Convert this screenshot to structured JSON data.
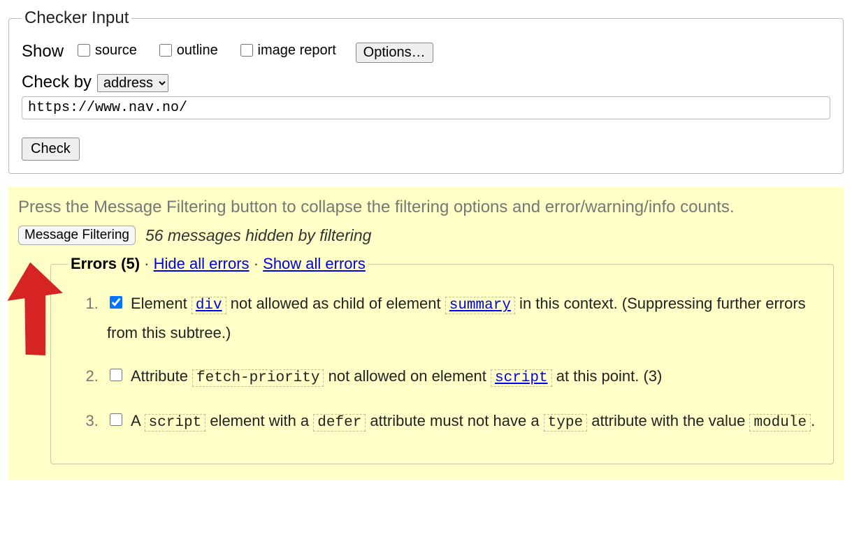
{
  "checker": {
    "legend": "Checker Input",
    "show_label": "Show",
    "source_label": "source",
    "outline_label": "outline",
    "image_report_label": "image report",
    "options_button": "Options…",
    "check_by_label": "Check by",
    "check_by_value": "address",
    "url_value": "https://www.nav.no/",
    "check_button": "Check"
  },
  "filter": {
    "hint": "Press the Message Filtering button to collapse the filtering options and error/warning/info counts.",
    "button": "Message Filtering",
    "hidden_text": "56 messages hidden by filtering"
  },
  "errors": {
    "title": "Errors (5)",
    "hide_all": "Hide all errors",
    "show_all": "Show all errors",
    "items": [
      {
        "checked": true,
        "parts": [
          {
            "text": "Element "
          },
          {
            "code": "div",
            "link": true
          },
          {
            "text": " not allowed as child of element "
          },
          {
            "code": "summary",
            "link": true
          },
          {
            "text": " in this context. (Suppressing further errors from this subtree.)"
          }
        ]
      },
      {
        "checked": false,
        "parts": [
          {
            "text": "Attribute "
          },
          {
            "code": "fetch-priority"
          },
          {
            "text": " not allowed on element "
          },
          {
            "code": "script",
            "link": true
          },
          {
            "text": " at this point. (3)"
          }
        ]
      },
      {
        "checked": false,
        "parts": [
          {
            "text": "A "
          },
          {
            "code": "script"
          },
          {
            "text": " element with a "
          },
          {
            "code": "defer"
          },
          {
            "text": " attribute must not have a "
          },
          {
            "code": "type"
          },
          {
            "text": " attribute with the value "
          },
          {
            "code": "module"
          },
          {
            "text": "."
          }
        ]
      }
    ]
  }
}
